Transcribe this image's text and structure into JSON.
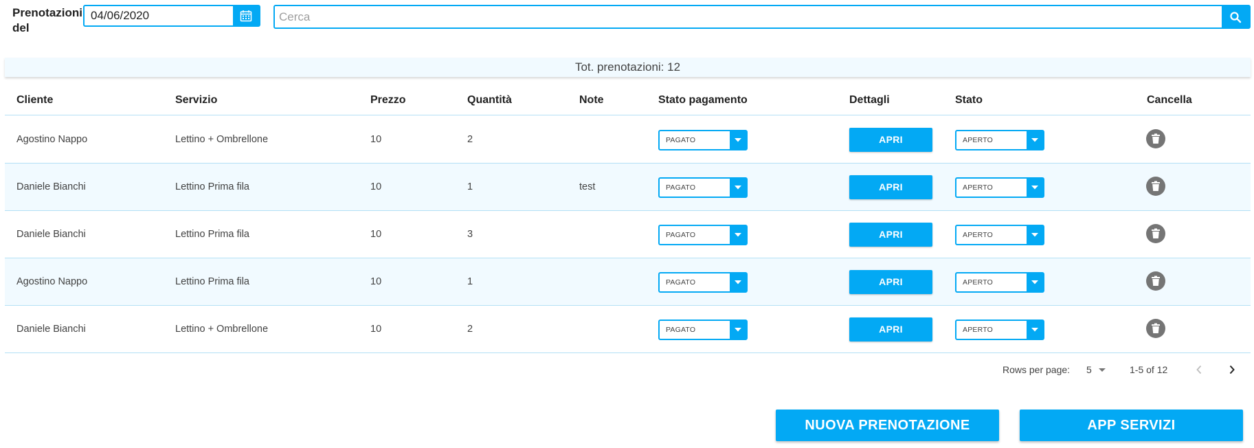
{
  "filter": {
    "date_label": "Prenotazioni del",
    "date_value": "04/06/2020",
    "search_placeholder": "Cerca"
  },
  "summary": "Tot. prenotazioni: 12",
  "columns": {
    "cliente": "Cliente",
    "servizio": "Servizio",
    "prezzo": "Prezzo",
    "quantita": "Quantità",
    "note": "Note",
    "stato_pagamento": "Stato pagamento",
    "dettagli": "Dettagli",
    "stato": "Stato",
    "cancella": "Cancella"
  },
  "rows": [
    {
      "cliente": "Agostino Nappo",
      "servizio": "Lettino + Ombrellone",
      "prezzo": "10",
      "quantita": "2",
      "note": "",
      "pagamento": "PAGATO",
      "dettagli": "APRI",
      "stato": "APERTO"
    },
    {
      "cliente": "Daniele Bianchi",
      "servizio": "Lettino Prima fila",
      "prezzo": "10",
      "quantita": "1",
      "note": "test",
      "pagamento": "PAGATO",
      "dettagli": "APRI",
      "stato": "APERTO"
    },
    {
      "cliente": "Daniele Bianchi",
      "servizio": "Lettino Prima fila",
      "prezzo": "10",
      "quantita": "3",
      "note": "",
      "pagamento": "PAGATO",
      "dettagli": "APRI",
      "stato": "APERTO"
    },
    {
      "cliente": "Agostino Nappo",
      "servizio": "Lettino Prima fila",
      "prezzo": "10",
      "quantita": "1",
      "note": "",
      "pagamento": "PAGATO",
      "dettagli": "APRI",
      "stato": "APERTO"
    },
    {
      "cliente": "Daniele Bianchi",
      "servizio": "Lettino + Ombrellone",
      "prezzo": "10",
      "quantita": "2",
      "note": "",
      "pagamento": "PAGATO",
      "dettagli": "APRI",
      "stato": "APERTO"
    }
  ],
  "pagination": {
    "rows_per_page_label": "Rows per page:",
    "rows_per_page_value": "5",
    "range": "1-5 of 12"
  },
  "actions": {
    "new_booking": "NUOVA PRENOTAZIONE",
    "app_services": "APP SERVIZI"
  },
  "icons": {
    "calendar": "calendar-icon",
    "search": "search-icon",
    "dropdown": "caret-down-icon",
    "trash": "trash-icon",
    "prev": "chevron-left-icon",
    "next": "chevron-right-icon"
  },
  "colors": {
    "accent": "#03a9f4",
    "row_alt": "#f1faff",
    "icon_grey": "#757575"
  }
}
